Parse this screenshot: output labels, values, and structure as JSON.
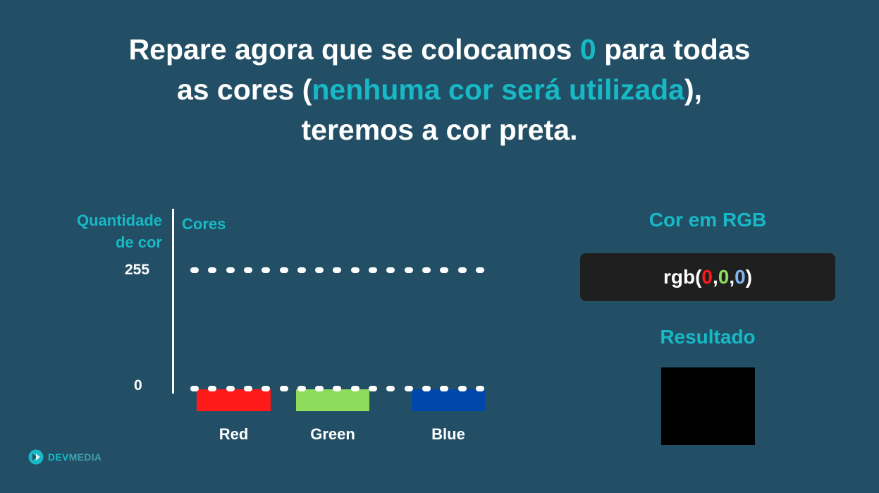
{
  "headline": {
    "line1_pre": "Repare agora que se colocamos ",
    "line1_hl": "0",
    "line1_post": " para todas",
    "line2_pre": "as cores (",
    "line2_hl": "nenhuma cor será utilizada",
    "line2_post": "),",
    "line3": "teremos a cor preta."
  },
  "chart": {
    "y_title_line1": "Quantidade",
    "y_title_line2": "de cor",
    "x_title": "Cores",
    "tick_max": "255",
    "tick_min": "0",
    "bars": [
      {
        "label": "Red",
        "value": 0,
        "color": "#ff1a1a"
      },
      {
        "label": "Green",
        "value": 0,
        "color": "#8ddc5c"
      },
      {
        "label": "Blue",
        "value": 0,
        "color": "#0047ab"
      }
    ]
  },
  "rgb": {
    "title": "Cor em RGB",
    "prefix": "rgb(",
    "r": "0",
    "sep1": ", ",
    "g": "0",
    "sep2": ", ",
    "b": "0",
    "suffix": ")",
    "r_color": "#ff1a1a",
    "g_color": "#8ddc5c",
    "b_color": "#7fb9f0"
  },
  "result": {
    "title": "Resultado",
    "color": "#000000"
  },
  "logo": {
    "text_bold": "DEV",
    "text_rest": "MEDIA",
    "icon": "devmedia-logo-icon"
  }
}
